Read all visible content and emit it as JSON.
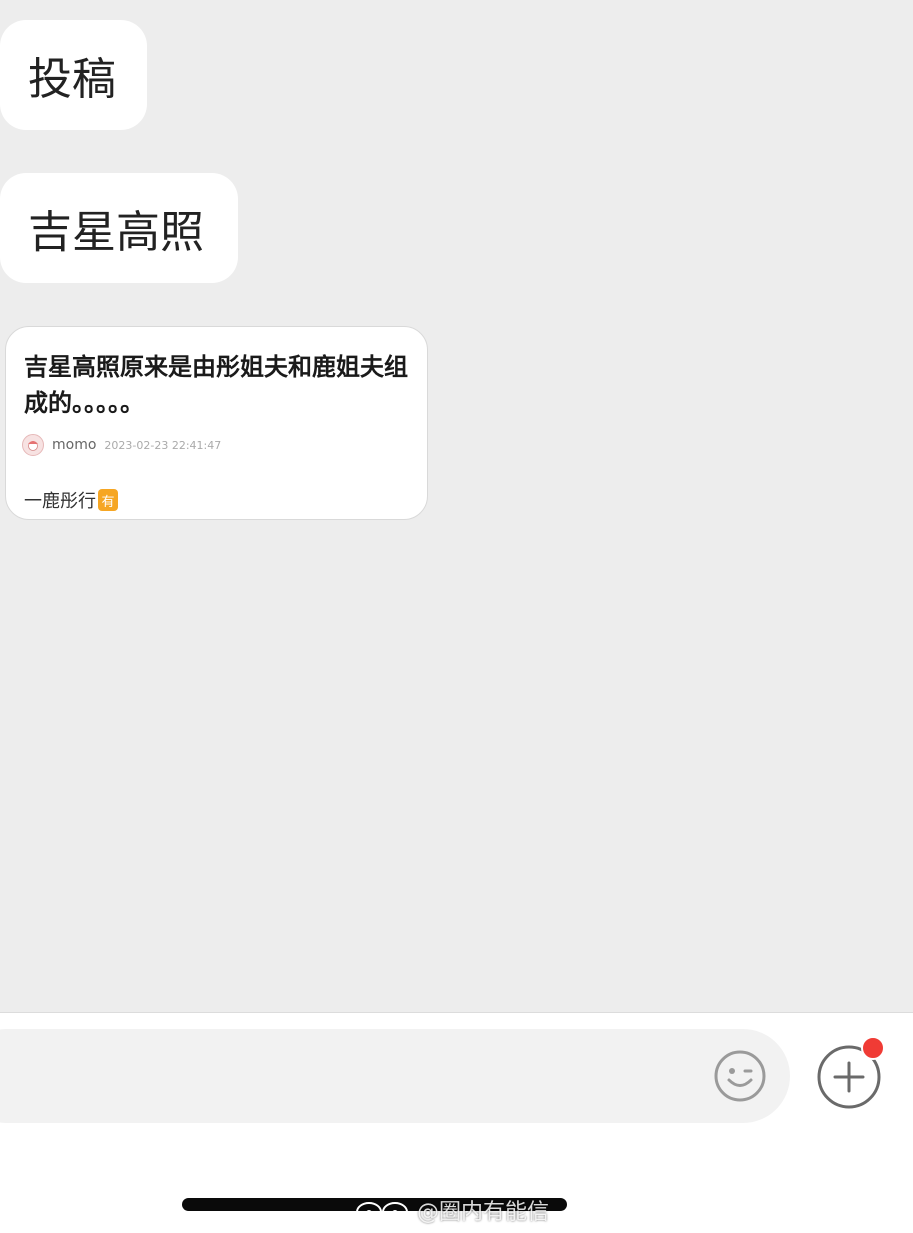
{
  "messages": [
    {
      "text": "投稿"
    },
    {
      "text": "吉星高照"
    }
  ],
  "shared_card": {
    "title": "吉星高照原来是由彤姐夫和鹿姐夫组成的。。。。。",
    "author": "momo",
    "timestamp": "2023-02-23 22:41:47",
    "source": "一鹿彤行",
    "source_badge": "有",
    "badge_color": "#f6a623"
  },
  "input_bar": {
    "placeholder": "",
    "emoji_icon": "smiley-icon",
    "plus_icon": "plus-circle-icon",
    "notification_dot_color": "#f03b35"
  },
  "watermark": {
    "text": "@圈内有能信"
  },
  "colors": {
    "chat_background": "#ededed",
    "bubble_background": "#ffffff",
    "input_background": "#f2f2f2"
  }
}
